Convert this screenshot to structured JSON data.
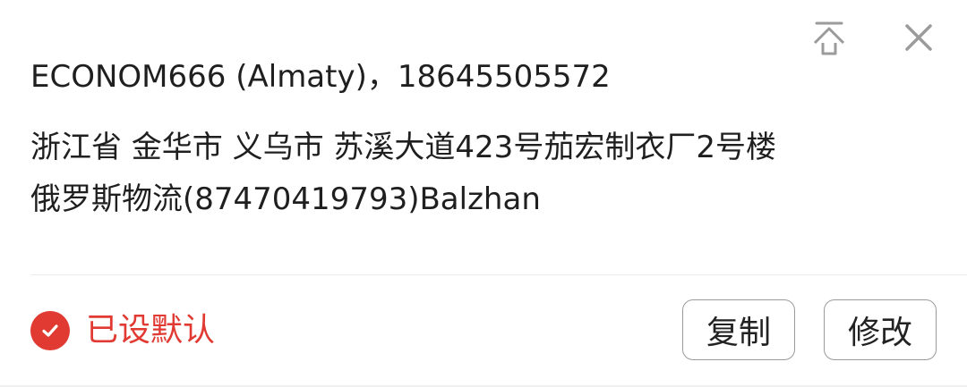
{
  "card": {
    "recipient_line": "ECONOM666 (Almaty)，18645505572",
    "address_line_1": "浙江省 金华市 义乌市 苏溪大道423号茄宏制衣厂2号楼",
    "address_line_2": "俄罗斯物流(87470419793)Balzhan",
    "default_label": "已设默认",
    "copy_button": "复制",
    "edit_button": "修改"
  },
  "icons": {
    "pin_top": "pin-top-icon",
    "close": "close-icon",
    "check": "check-circle-icon"
  },
  "colors": {
    "accent": "#e03a32",
    "text": "#1f1f1f",
    "icon": "#9b9b9b",
    "border": "#9a9a9a"
  }
}
